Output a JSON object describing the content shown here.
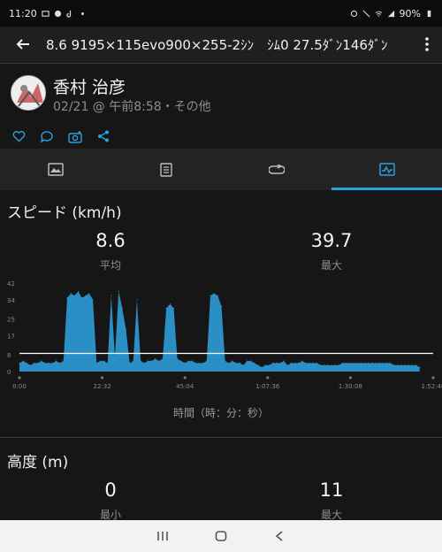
{
  "status_bar": {
    "time": "11:20",
    "battery": "90%"
  },
  "toolbar": {
    "title": "8.6 9195×115evo900×255-2ｼﾝ　ｼﾑ0 27.5ﾀﾞﾝ146ﾀﾞﾝ"
  },
  "activity": {
    "user_name": "香村 治彦",
    "meta": "02/21 @ 午前8:58・その他"
  },
  "tabs": [
    "overview-icon",
    "details-icon",
    "laps-icon",
    "charts-icon"
  ],
  "speed": {
    "title": "スピード (km/h)",
    "avg_value": "8.6",
    "avg_label": "平均",
    "max_value": "39.7",
    "max_label": "最大"
  },
  "chart_data": {
    "type": "area",
    "title": "スピード (km/h)",
    "xlabel": "時間（時：分：秒）",
    "ylabel": "",
    "ylim": [
      0,
      42
    ],
    "yticks": [
      "42",
      "34",
      "25",
      "17",
      "8",
      "0"
    ],
    "xticks": [
      "0:00",
      "22:32",
      "45:04",
      "1:07:36",
      "1:30:08",
      "1:52:40"
    ],
    "reference_line": 8.6,
    "x_minutes": [
      0,
      1,
      2,
      3,
      4,
      5,
      6,
      7,
      8,
      9,
      10,
      11,
      12,
      13,
      14,
      15,
      16,
      17,
      18,
      19,
      20,
      21,
      22,
      23,
      24,
      25,
      26,
      27,
      28,
      29,
      30,
      31,
      32,
      33,
      34,
      35,
      36,
      37,
      38,
      39,
      40,
      41,
      42,
      43,
      44,
      45,
      46,
      47,
      48,
      49,
      50,
      51,
      52,
      53,
      54,
      55,
      56,
      57,
      58,
      59,
      60,
      61,
      62,
      63,
      64,
      65,
      66,
      67,
      68,
      69,
      70,
      71,
      72,
      73,
      74,
      75,
      76,
      77,
      78,
      79,
      80,
      81,
      82,
      83,
      84,
      85,
      86,
      87,
      88,
      89,
      90,
      91,
      92,
      93,
      94,
      95,
      96,
      97,
      98,
      99,
      100,
      101,
      102,
      103,
      104,
      105,
      106,
      107,
      108,
      109
    ],
    "values": [
      4,
      5,
      4,
      3,
      4,
      4,
      5,
      4,
      4,
      4,
      5,
      4,
      5,
      35,
      37,
      36,
      38,
      35,
      36,
      37,
      34,
      4,
      5,
      5,
      4,
      36,
      7,
      38,
      30,
      20,
      4,
      5,
      34,
      5,
      4,
      5,
      5,
      6,
      5,
      6,
      30,
      32,
      30,
      6,
      5,
      4,
      5,
      5,
      4,
      4,
      4,
      5,
      36,
      37,
      36,
      31,
      5,
      4,
      5,
      4,
      4,
      3,
      5,
      5,
      4,
      3,
      2,
      3,
      3,
      4,
      4,
      4,
      5,
      3,
      4,
      4,
      4,
      5,
      4,
      4,
      4,
      4,
      3,
      3,
      3,
      3,
      3,
      3,
      4,
      4,
      4,
      4,
      4,
      4,
      4,
      4,
      4,
      4,
      4,
      4,
      4,
      4,
      3,
      3,
      3,
      3,
      3,
      3,
      3,
      2
    ],
    "color": "#2b96cf"
  },
  "elevation": {
    "title": "高度 (m)",
    "min_value": "0",
    "min_label": "最小",
    "max_value": "11",
    "max_label": "最大"
  }
}
